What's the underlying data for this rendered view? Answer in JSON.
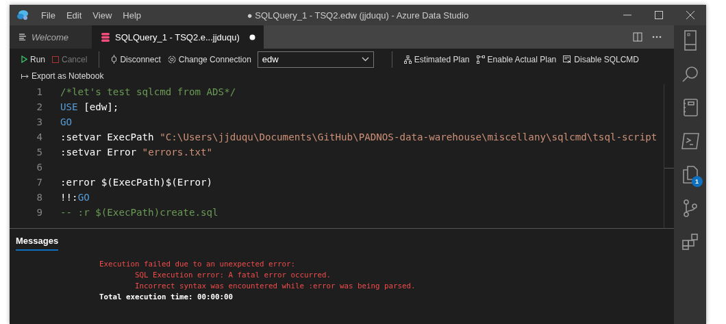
{
  "window": {
    "title": "● SQLQuery_1 - TSQ2.edw (jjduqu) - Azure Data Studio"
  },
  "menu": [
    "File",
    "Edit",
    "View",
    "Help"
  ],
  "tabs": [
    {
      "label": "Welcome",
      "kind": "welcome",
      "selected": false,
      "dirty": false
    },
    {
      "label": "SQLQuery_1 - TSQ2.e...jjduqu)",
      "kind": "query",
      "selected": true,
      "dirty": true
    }
  ],
  "toolbar": {
    "run": "Run",
    "cancel": "Cancel",
    "cancel_disabled": true,
    "disconnect": "Disconnect",
    "change_connection": "Change Connection",
    "database": "edw",
    "estimated_plan": "Estimated Plan",
    "actual_plan": "Enable Actual Plan",
    "sqlcmd": "Disable SQLCMD",
    "export": "Export as Notebook"
  },
  "editor": {
    "lines": [
      {
        "number": "1",
        "tokens": [
          {
            "kind": "comment",
            "text": "/*let's test sqlcmd from ADS*/"
          }
        ]
      },
      {
        "number": "2",
        "tokens": [
          {
            "kind": "keyword",
            "text": "USE"
          },
          {
            "kind": "plain",
            "text": " [edw];"
          }
        ]
      },
      {
        "number": "3",
        "tokens": [
          {
            "kind": "keyword",
            "text": "GO"
          }
        ]
      },
      {
        "number": "4",
        "tokens": [
          {
            "kind": "plain",
            "text": ":setvar ExecPath "
          },
          {
            "kind": "string",
            "text": "\"C:\\Users\\jjduqu\\Documents\\GitHub\\PADNOS-data-warehouse\\miscellany\\sqlcmd\\tsql-script"
          }
        ]
      },
      {
        "number": "5",
        "tokens": [
          {
            "kind": "plain",
            "text": ":setvar Error "
          },
          {
            "kind": "string",
            "text": "\"errors.txt\""
          }
        ]
      },
      {
        "number": "6"
      },
      {
        "number": "7",
        "tokens": [
          {
            "kind": "plain",
            "text": ":error $(ExecPath)$(Error)"
          }
        ]
      },
      {
        "number": "8",
        "tokens": [
          {
            "kind": "plain",
            "text": "!!:"
          },
          {
            "kind": "keyword",
            "text": "GO"
          }
        ]
      },
      {
        "number": "9",
        "tokens": [
          {
            "kind": "comment",
            "text": "-- :r $(ExecPath)create.sql"
          }
        ]
      }
    ]
  },
  "panel": {
    "tabs": [
      {
        "label": "Messages",
        "selected": true
      }
    ],
    "messages": [
      {
        "kind": "error",
        "indent": false,
        "text": "Execution failed due to an unexpected error:"
      },
      {
        "kind": "error",
        "indent": true,
        "text": "SQL Execution error: A fatal error occurred."
      },
      {
        "kind": "error",
        "indent": true,
        "text": "Incorrect syntax was encountered while :error was being parsed."
      },
      {
        "kind": "info",
        "indent": false,
        "text": "Total execution time: 00:00:00"
      }
    ]
  },
  "activity_bar": {
    "files_badge": "1"
  }
}
